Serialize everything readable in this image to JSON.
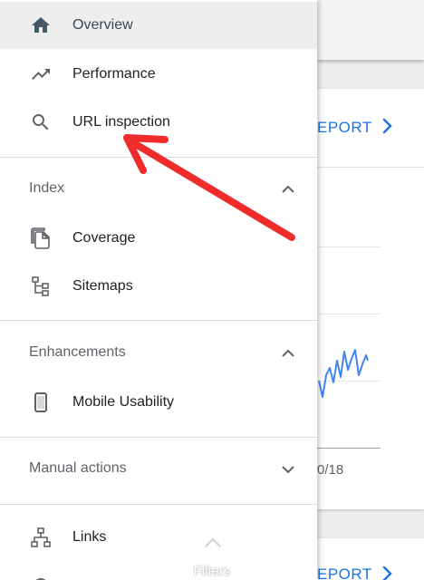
{
  "background": {
    "report_link_top": "EPORT",
    "report_link_bottom": "EPORT",
    "date_tick": "0/18"
  },
  "sidebar": {
    "items": [
      {
        "label": "Overview",
        "icon": "home-icon",
        "active": true
      },
      {
        "label": "Performance",
        "icon": "trending-up-icon"
      },
      {
        "label": "URL inspection",
        "icon": "search-icon"
      }
    ],
    "sections": [
      {
        "label": "Index",
        "expanded": true,
        "items": [
          {
            "label": "Coverage",
            "icon": "copy-pages-icon"
          },
          {
            "label": "Sitemaps",
            "icon": "sitemap-icon"
          }
        ]
      },
      {
        "label": "Enhancements",
        "expanded": true,
        "items": [
          {
            "label": "Mobile Usability",
            "icon": "smartphone-icon"
          }
        ]
      },
      {
        "label": "Manual actions",
        "expanded": false,
        "items": []
      }
    ],
    "bottom_items": [
      {
        "label": "Links",
        "icon": "links-tree-icon"
      }
    ]
  },
  "filters": {
    "label": "Filters"
  },
  "colors": {
    "accent": "#1a73e8",
    "annotation": "#f44336",
    "icon": "#5f6368",
    "active_icon": "#455a64"
  }
}
